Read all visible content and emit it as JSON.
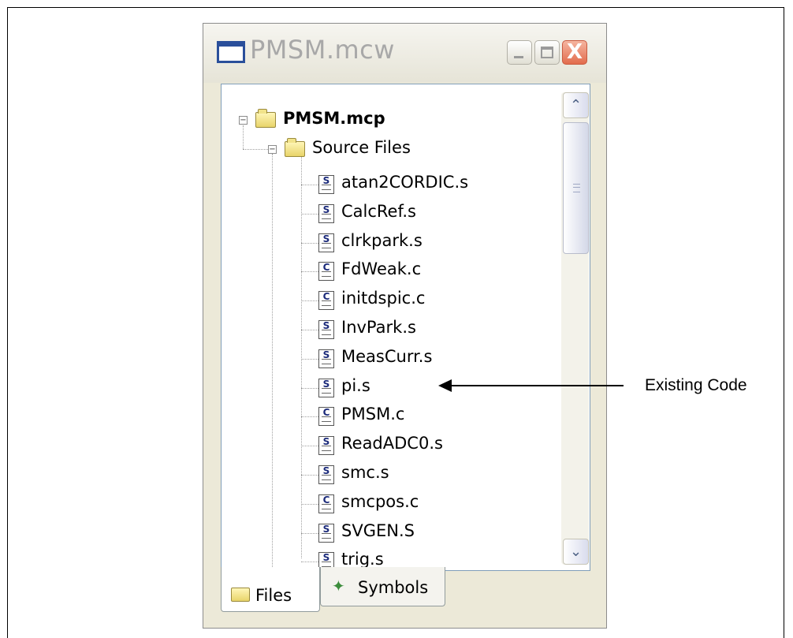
{
  "window": {
    "title": "PMSM.mcw",
    "minimize_label": "_",
    "close_label": "X"
  },
  "tree": {
    "project": {
      "label": "PMSM.mcp",
      "expander": "−"
    },
    "folder": {
      "label": "Source Files",
      "expander": "−"
    },
    "files": [
      {
        "label": "atan2CORDIC.s",
        "icon": "S"
      },
      {
        "label": "CalcRef.s",
        "icon": "S"
      },
      {
        "label": "clrkpark.s",
        "icon": "S"
      },
      {
        "label": "FdWeak.c",
        "icon": "C"
      },
      {
        "label": "initdspic.c",
        "icon": "C"
      },
      {
        "label": "InvPark.s",
        "icon": "S"
      },
      {
        "label": "MeasCurr.s",
        "icon": "S"
      },
      {
        "label": "pi.s",
        "icon": "S"
      },
      {
        "label": "PMSM.c",
        "icon": "C"
      },
      {
        "label": "ReadADC0.s",
        "icon": "S"
      },
      {
        "label": "smc.s",
        "icon": "S"
      },
      {
        "label": "smcpos.c",
        "icon": "C"
      },
      {
        "label": "SVGEN.S",
        "icon": "S"
      },
      {
        "label": "trig.s",
        "icon": "S"
      }
    ]
  },
  "scrollbar": {
    "up_glyph": "⌃",
    "down_glyph": "⌄"
  },
  "tabs": [
    {
      "label": "Files",
      "active": true
    },
    {
      "label": "Symbols",
      "active": false
    }
  ],
  "annotation": {
    "text": "Existing Code"
  }
}
